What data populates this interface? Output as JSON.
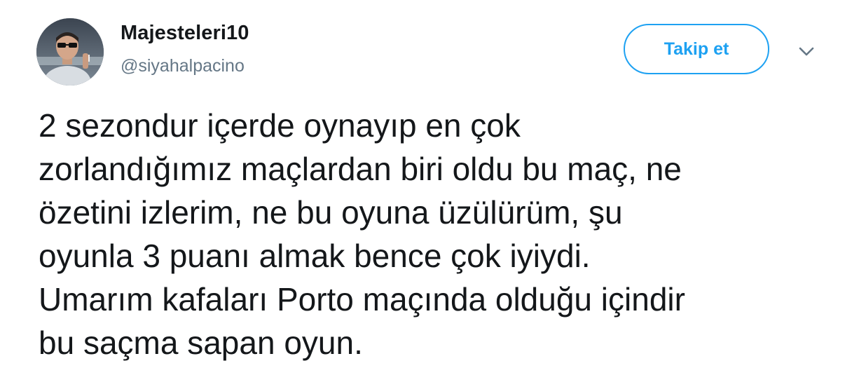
{
  "user": {
    "display_name": "Majesteleri10",
    "handle": "@siyahalpacino"
  },
  "actions": {
    "follow_label": "Takip et"
  },
  "tweet": {
    "lines": [
      "2 sezondur içerde oynayıp en çok",
      "zorlandığımız maçlardan biri oldu bu maç, ne",
      "özetini izlerim, ne bu oyuna üzülürüm, şu",
      "oyunla 3 puanı almak bence çok iyiydi.",
      "Umarım kafaları Porto maçında olduğu içindir",
      "bu saçma sapan oyun."
    ]
  },
  "icons": {
    "avatar": "profile-photo",
    "menu": "chevron-down-icon"
  },
  "colors": {
    "accent": "#1da1f2",
    "text": "#14171a",
    "secondary_text": "#657786"
  }
}
